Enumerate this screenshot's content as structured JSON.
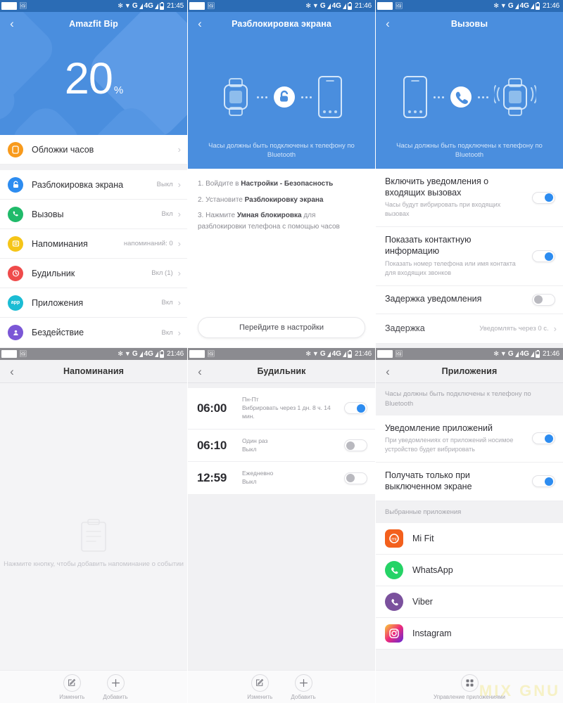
{
  "statusbar": {
    "icons": [
      "bluetooth-icon",
      "wifi-icon",
      "g-signal-icon",
      "4g-signal-icon",
      "battery-icon"
    ],
    "bluetooth": "✻",
    "wifi": "▼",
    "g_label": "G",
    "fourg_label": "4G",
    "time_1": "21:45",
    "time_2": "21:46"
  },
  "panel1": {
    "title": "Amazfit Bip",
    "battery_value": "20",
    "battery_unit": "%",
    "items": [
      {
        "label": "Обложки часов",
        "value": "",
        "color": "#f89a1c",
        "icon": "watch-face-icon"
      },
      {
        "label": "Разблокировка экрана",
        "value": "Выкл",
        "color": "#2d8cf0",
        "icon": "unlock-icon"
      },
      {
        "label": "Вызовы",
        "value": "Вкл",
        "color": "#20ba6a",
        "icon": "phone-icon"
      },
      {
        "label": "Напоминания",
        "value": "напоминаний: 0",
        "color": "#f5c518",
        "icon": "reminder-icon"
      },
      {
        "label": "Будильник",
        "value": "Вкл (1)",
        "color": "#ef4b4b",
        "icon": "alarm-clock-icon"
      },
      {
        "label": "Приложения",
        "value": "Вкл",
        "color": "#1bbcd4",
        "icon": "apps-icon"
      },
      {
        "label": "Бездействие",
        "value": "Вкл",
        "color": "#7b57d6",
        "icon": "sedentary-icon"
      }
    ]
  },
  "panel2": {
    "title": "Разблокировка экрана",
    "banner_note": "Часы должны быть подключены к телефону по Bluetooth",
    "steps": [
      {
        "prefix": "1. Войдите в ",
        "bold": "Настройки - Безопасность",
        "suffix": ""
      },
      {
        "prefix": "2. Установите ",
        "bold": "Разблокировку экрана",
        "suffix": ""
      },
      {
        "prefix": "3. Нажмите ",
        "bold": "Умная блокировка",
        "suffix": " для разблокировки телефона с помощью часов"
      }
    ],
    "button": "Перейдите в настройки"
  },
  "panel3": {
    "title": "Вызовы",
    "banner_note": "Часы должны быть подключены к телефону по Bluetooth",
    "settings": [
      {
        "title": "Включить уведомления о входящих вызовах",
        "sub": "Часы будут вибрировать при входящих вызовах",
        "state": "on"
      },
      {
        "title": "Показать контактную информацию",
        "sub": "Показать номер телефона или имя контакта для входящих звонков",
        "state": "on"
      },
      {
        "title": "Задержка уведомления",
        "sub": "",
        "state": "off"
      }
    ],
    "delay_row": {
      "label": "Задержка",
      "value": "Уведомлять через 0 с."
    }
  },
  "panel4": {
    "title": "Напоминания",
    "empty_text": "Нажмите кнопку, чтобы добавить напоминание о событии",
    "empty_icon": "clipboard-icon",
    "bottom": {
      "edit_label": "Изменить",
      "add_label": "Добавить",
      "edit_icon": "edit-square-icon",
      "add_icon": "plus-icon"
    }
  },
  "panel5": {
    "title": "Будильник",
    "alarms": [
      {
        "time": "06:00",
        "repeat": "Пн-Пт",
        "status": "Вибрировать через 1 дн. 8 ч. 14 мин.",
        "state": "on"
      },
      {
        "time": "06:10",
        "repeat": "Один раз",
        "status": "Выкл",
        "state": "off"
      },
      {
        "time": "12:59",
        "repeat": "Ежедневно",
        "status": "Выкл",
        "state": "off"
      }
    ],
    "bottom": {
      "edit_label": "Изменить",
      "add_label": "Добавить",
      "edit_icon": "edit-square-icon",
      "add_icon": "plus-icon"
    }
  },
  "panel6": {
    "title": "Приложения",
    "banner_note": "Часы должны быть подключены к телефону по Bluetooth",
    "settings": [
      {
        "title": "Уведомление приложений",
        "sub": "При уведомлениях от приложений носимое устройство будет вибрировать",
        "state": "on"
      },
      {
        "title": "Получать только при выключенном экране",
        "sub": "",
        "state": "on"
      }
    ],
    "section_label": "Выбранные приложения",
    "apps": [
      {
        "name": "Mi Fit",
        "icon": "mi-fit-icon",
        "color": "#f3601d"
      },
      {
        "name": "WhatsApp",
        "icon": "whatsapp-icon",
        "color": "#25d366"
      },
      {
        "name": "Viber",
        "icon": "viber-icon",
        "color": "#7b519d"
      },
      {
        "name": "Instagram",
        "icon": "instagram-icon",
        "color": "#c13584"
      }
    ],
    "bottom": {
      "manage_label": "Управление приложениями",
      "manage_icon": "grid-apps-icon"
    },
    "watermark": "MIX GNU"
  },
  "colors": {
    "accent": "#2d8cf0",
    "hero": "#4a8ede",
    "statusbar_blue": "#2b6cb5",
    "statusbar_grey": "#8b8b90"
  }
}
